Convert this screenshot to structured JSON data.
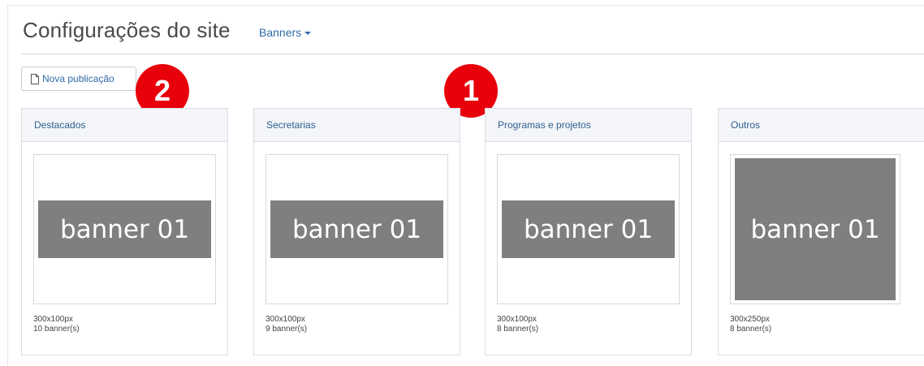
{
  "header": {
    "title": "Configurações do site",
    "section_dropdown": "Banners"
  },
  "toolbar": {
    "new_publication_label": "Nova publicação"
  },
  "annotations": [
    {
      "number": "2"
    },
    {
      "number": "1"
    }
  ],
  "cards": [
    {
      "title": "Destacados",
      "banner_text": "banner 01",
      "size": "300x100px",
      "count": "10 banner(s)"
    },
    {
      "title": "Secretarias",
      "banner_text": "banner 01",
      "size": "300x100px",
      "count": "9 banner(s)"
    },
    {
      "title": "Programas e projetos",
      "banner_text": "banner 01",
      "size": "300x100px",
      "count": "8 banner(s)"
    },
    {
      "title": "Outros",
      "banner_text": "banner 01",
      "size": "300x250px",
      "count": "8 banner(s)"
    }
  ],
  "colors": {
    "accent": "#2f6aa8",
    "marker": "#e8000b",
    "banner_gray": "#7f7f7f"
  }
}
